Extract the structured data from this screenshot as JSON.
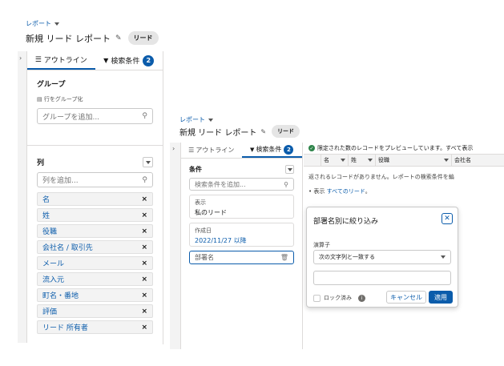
{
  "back": {
    "breadcrumb": "レポート",
    "title": "新規 リード レポート",
    "type_badge": "リード",
    "tabs": [
      {
        "label": "アウトライン"
      },
      {
        "label": "検索条件",
        "count": "2"
      }
    ],
    "group_heading": "グループ",
    "group_rows_label": "行をグループ化",
    "group_add_placeholder": "グループを追加...",
    "columns_heading": "列",
    "columns_add_placeholder": "列を追加...",
    "columns": [
      "名",
      "姓",
      "役職",
      "会社名 / 取引先",
      "メール",
      "流入元",
      "町名・番地",
      "評価",
      "リード 所有者"
    ]
  },
  "front": {
    "breadcrumb": "レポート",
    "title": "新規 リード レポート",
    "type_badge": "リード",
    "tabs": [
      {
        "label": "アウトライン"
      },
      {
        "label": "検索条件",
        "count": "2"
      }
    ],
    "filters_heading": "条件",
    "filter_add_placeholder": "検索条件を追加...",
    "filters": [
      {
        "label": "表示",
        "value": "私のリード"
      },
      {
        "label": "作成日",
        "value": "2022/11/27 以降"
      }
    ],
    "new_filter_label": "部署名",
    "preview_notice": "限定された数のレコードをプレビューしています。すべて表示",
    "grid_columns": [
      "名",
      "姓",
      "役職",
      "会社名"
    ],
    "empty_message": "返されるレコードがありません。レポートの検索条件を編",
    "show_prefix": "• 表示",
    "show_link": "すべてのリード",
    "show_suffix": "。",
    "popover": {
      "title": "部署名別に絞り込み",
      "operator_label": "演算子",
      "operator_value": "次の文字列と一致する",
      "value_input": "",
      "lock_label": "ロック済み",
      "cancel": "キャンセル",
      "apply": "適用"
    }
  },
  "colors": {
    "brand": "#0b5cab",
    "panel": "#f3f3f3",
    "border": "#dddbda"
  }
}
